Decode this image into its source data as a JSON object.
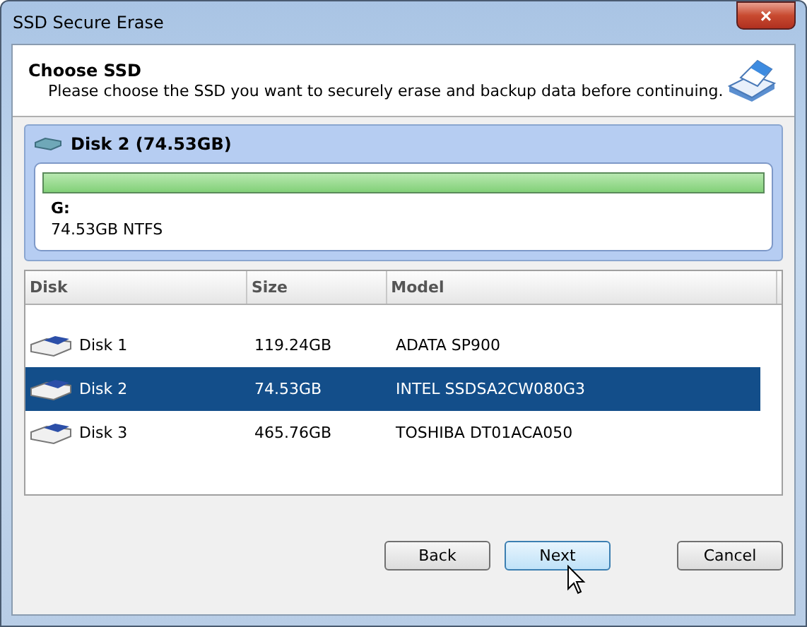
{
  "window": {
    "title": "SSD Secure Erase",
    "close": "×"
  },
  "header": {
    "title": "Choose SSD",
    "description": "Please choose the SSD you want to securely erase and backup data before continuing."
  },
  "disk_panel": {
    "title": "Disk 2 (74.53GB)",
    "partition": {
      "letter": "G:",
      "info": "74.53GB NTFS",
      "level": 1
    }
  },
  "table": {
    "columns": [
      "Disk",
      "Size",
      "Model"
    ],
    "rows": [
      {
        "disk": "Disk 1",
        "size": "119.24GB",
        "model": "ADATA SP900",
        "selected": false
      },
      {
        "disk": "Disk 2",
        "size": "74.53GB",
        "model": "INTEL SSDSA2CW080G3",
        "selected": true
      },
      {
        "disk": "Disk 3",
        "size": "465.76GB",
        "model": "TOSHIBA DT01ACA050",
        "selected": false
      }
    ]
  },
  "buttons": [
    {
      "label": "Back",
      "hovered": false
    },
    {
      "label": "Next",
      "hovered": true
    },
    {
      "label": "Cancel",
      "hovered": false
    }
  ]
}
